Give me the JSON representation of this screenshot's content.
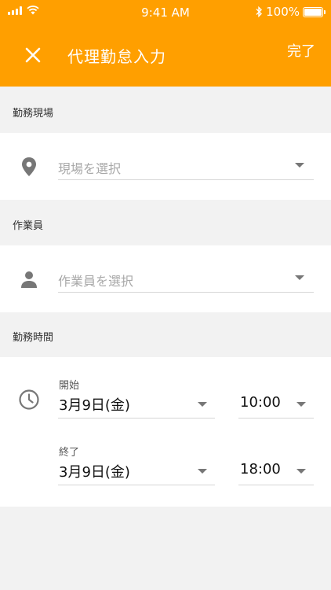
{
  "status_bar": {
    "time": "9:41 AM",
    "battery": "100%"
  },
  "app_bar": {
    "title": "代理勤怠入力",
    "done_label": "完了"
  },
  "sections": {
    "site": {
      "header": "勤務現場",
      "placeholder": "現場を選択"
    },
    "worker": {
      "header": "作業員",
      "placeholder": "作業員を選択"
    },
    "work_time": {
      "header": "勤務時間",
      "start": {
        "label": "開始",
        "date": "3月9日(金)",
        "time": "10:00"
      },
      "end": {
        "label": "終了",
        "date": "3月9日(金)",
        "time": "18:00"
      }
    }
  },
  "colors": {
    "accent": "#ff9f00",
    "background": "#f2f2f2"
  },
  "icons": [
    "close-icon",
    "location-pin-icon",
    "person-icon",
    "clock-icon",
    "dropdown-arrow-icon"
  ]
}
